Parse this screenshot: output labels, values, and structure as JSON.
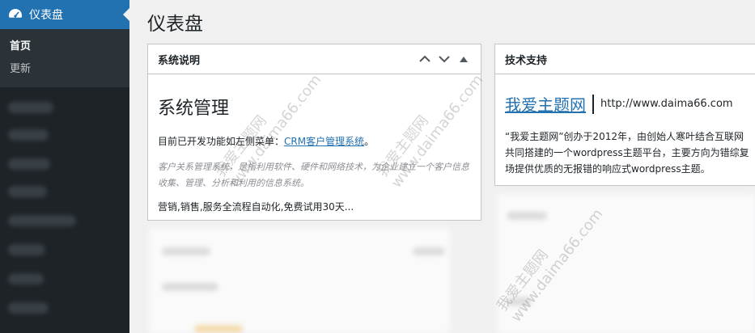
{
  "sidebar": {
    "dashboard_label": "仪表盘",
    "submenu": [
      {
        "label": "首页",
        "current": true
      },
      {
        "label": "更新",
        "current": false
      }
    ]
  },
  "page": {
    "title": "仪表盘"
  },
  "widget_system": {
    "title": "系统说明",
    "heading": "系统管理",
    "intro_prefix": "目前已开发功能如左侧菜单：",
    "intro_link": "CRM客户管理系统",
    "intro_suffix": "。",
    "description": "客户关系管理系统，是指利用软件、硬件和网络技术，为企业建立一个客户信息收集、管理、分析和利用的信息系统。",
    "footer": "营销,销售,服务全流程自动化,免费试用30天..."
  },
  "widget_support": {
    "title": "技术支持",
    "brand": "我爱主题网",
    "url": "http://www.daima66.com",
    "text_lines": [
      "“我爱主题网”创办于2012年，由创始人寒叶结合互联网",
      "共同搭建的一个wordpress主题平台，主要方向为错综复",
      "场提供优质的无报错的响应式wordpress主题。"
    ]
  },
  "watermark": {
    "line1": "我爱主题网",
    "line2": "www.daima66.com"
  },
  "colors": {
    "sidebar_bg": "#1d2327",
    "active_menu": "#2271b1",
    "link": "#2271b1"
  }
}
